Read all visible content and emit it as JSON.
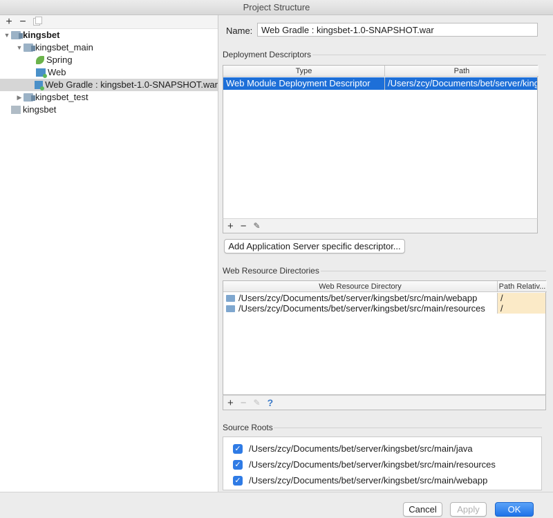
{
  "window": {
    "title": "Project Structure"
  },
  "left_toolbar": {
    "add": "+",
    "remove": "−"
  },
  "tree": [
    {
      "label": "kingsbet",
      "level": 0,
      "arrow": "▼",
      "icon": "module-icon",
      "bold": true
    },
    {
      "label": "kingsbet_main",
      "level": 1,
      "arrow": "▼",
      "icon": "module-icon",
      "bold": false
    },
    {
      "label": "Spring",
      "level": 2,
      "arrow": "",
      "icon": "spring-icon",
      "bold": false
    },
    {
      "label": "Web",
      "level": 2,
      "arrow": "",
      "icon": "web-icon",
      "bold": false
    },
    {
      "label": "Web Gradle : kingsbet-1.0-SNAPSHOT.war",
      "level": 2,
      "arrow": "",
      "icon": "web-icon",
      "bold": false,
      "selected": true
    },
    {
      "label": "kingsbet_test",
      "level": 1,
      "arrow": "▶",
      "icon": "module-icon",
      "bold": false
    },
    {
      "label": "kingsbet",
      "level": 0,
      "arrow": "",
      "icon": "module-grey-icon",
      "bold": false
    }
  ],
  "name": {
    "label": "Name:",
    "value": "Web Gradle : kingsbet-1.0-SNAPSHOT.war"
  },
  "deployment": {
    "title": "Deployment Descriptors",
    "columns": [
      "Type",
      "Path"
    ],
    "rows": [
      {
        "type": "Web Module Deployment Descriptor",
        "path": "/Users/zcy/Documents/bet/server/kingsbet/src/main/webapp/WEB-INF/web.xml"
      }
    ],
    "toolbar": {
      "add": "+",
      "remove": "−"
    },
    "add_server_button": "Add Application Server specific descriptor..."
  },
  "web_resources": {
    "title": "Web Resource Directories",
    "columns": [
      "Web Resource Directory",
      "Path Relativ..."
    ],
    "rows": [
      {
        "dir": "/Users/zcy/Documents/bet/server/kingsbet/src/main/webapp",
        "rel": "/"
      },
      {
        "dir": "/Users/zcy/Documents/bet/server/kingsbet/src/main/resources",
        "rel": "/"
      }
    ],
    "toolbar": {
      "add": "+",
      "remove": "−",
      "help": "?"
    }
  },
  "source_roots": {
    "title": "Source Roots",
    "items": [
      {
        "path": "/Users/zcy/Documents/bet/server/kingsbet/src/main/java",
        "checked": true
      },
      {
        "path": "/Users/zcy/Documents/bet/server/kingsbet/src/main/resources",
        "checked": true
      },
      {
        "path": "/Users/zcy/Documents/bet/server/kingsbet/src/main/webapp",
        "checked": true
      }
    ]
  },
  "buttons": {
    "cancel": "Cancel",
    "apply": "Apply",
    "ok": "OK"
  },
  "colors": {
    "selection": "#1d6fd8",
    "primary_button": "#1e73e8",
    "checkbox": "#2f7be5",
    "path_relative_bg": "#fbeac7"
  }
}
